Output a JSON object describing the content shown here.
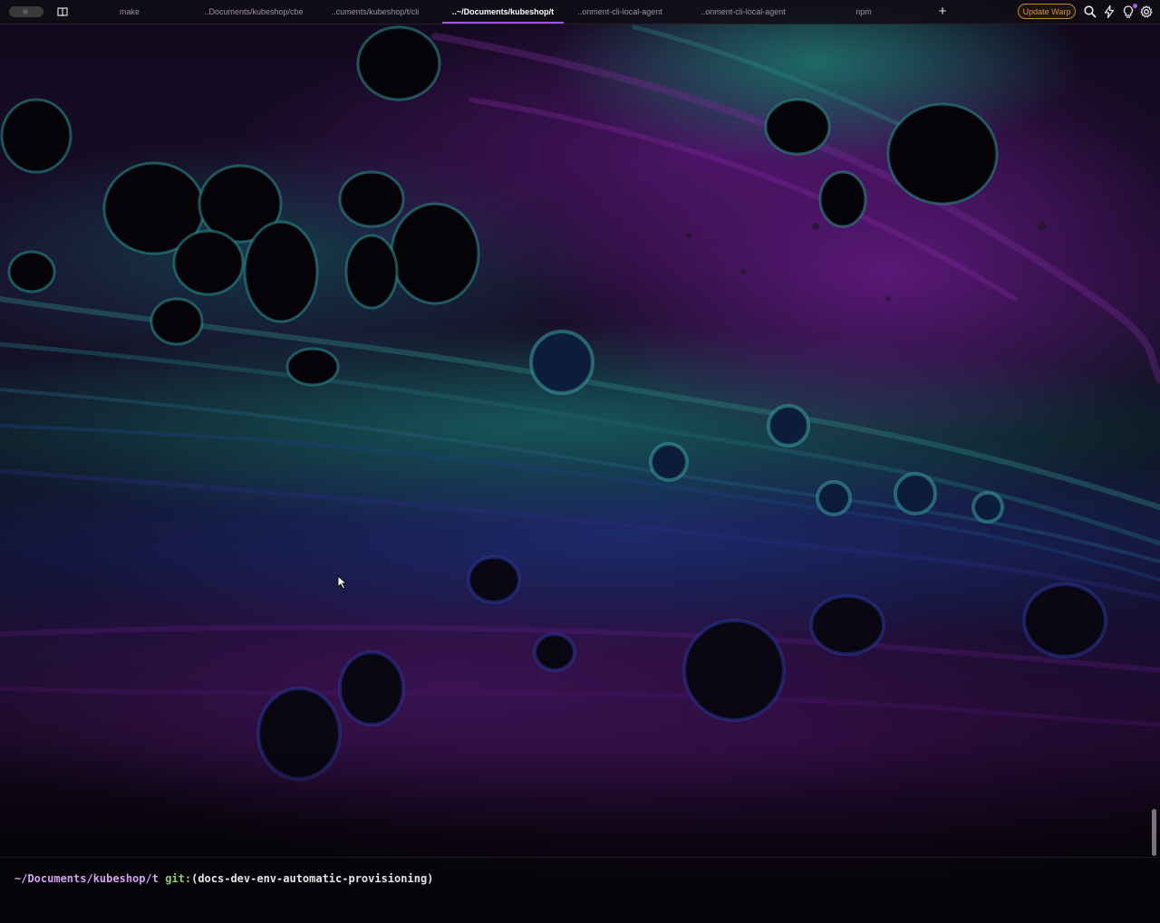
{
  "tabbar": {
    "tabs": [
      {
        "label": "make",
        "active": false
      },
      {
        "label": "..Documents/kubeshop/cbe",
        "active": false
      },
      {
        "label": "..cuments/kubeshop/t/cli",
        "active": false
      },
      {
        "label": "..~/Documents/kubeshop/t",
        "active": true
      },
      {
        "label": "..onment-cli-local-agent",
        "active": false
      },
      {
        "label": "..onment-cli-local-agent",
        "active": false
      },
      {
        "label": "npm",
        "active": false
      }
    ],
    "new_tab_label": "+",
    "update_label": "Update Warp",
    "icons": [
      "search-icon",
      "lightning-icon",
      "lightbulb-icon",
      "gear-icon"
    ],
    "accent_color": "#a355e0",
    "update_color": "#d9973a"
  },
  "terminal": {
    "prompt_dir": "~/Documents/kubeshop/t",
    "prompt_git": "git:",
    "prompt_branch": "(docs-dev-env-automatic-provisioning)",
    "dir_color": "#d2a4f0",
    "git_color": "#8ed06a"
  }
}
